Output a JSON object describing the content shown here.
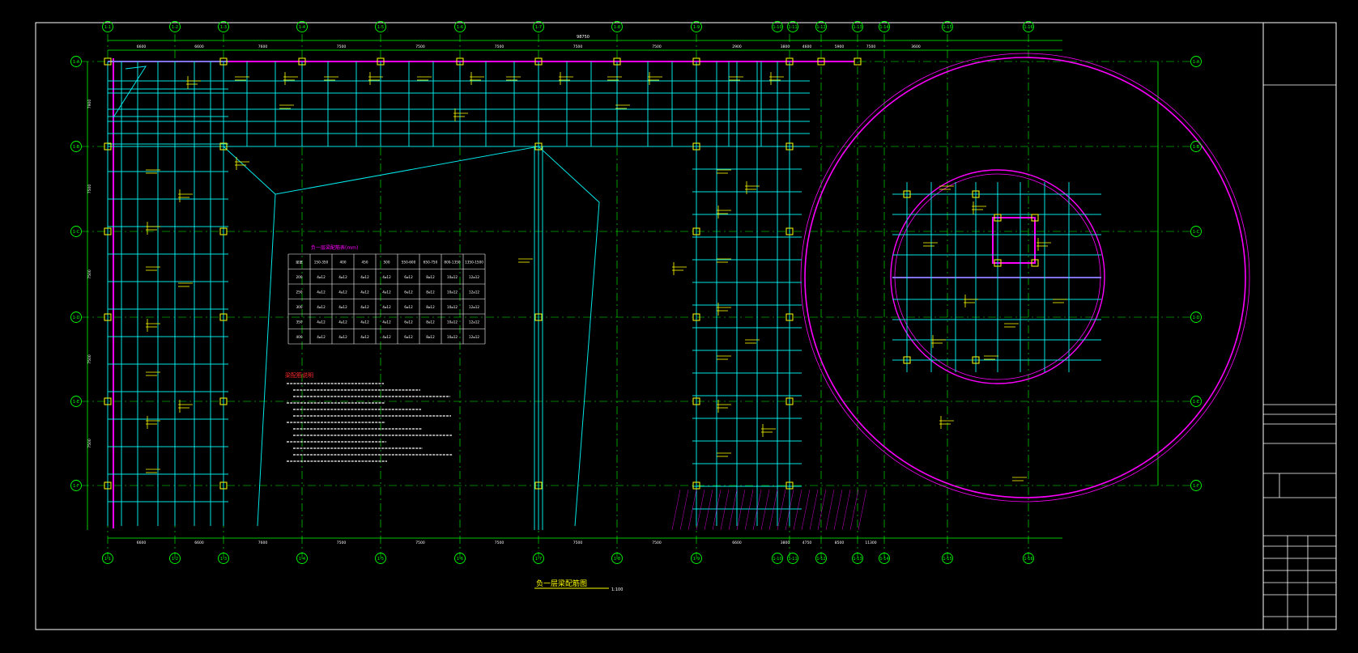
{
  "drawing": {
    "title": "负一层梁配筋图",
    "scale": "1:100",
    "notes_heading": "梁配筋说明",
    "table_title": "负一层梁配筋表(mm)",
    "table_headers": [
      "梁宽",
      "150-350",
      "400",
      "450",
      "500",
      "550-600",
      "650-750",
      "800-1350",
      "1350-1500"
    ],
    "table_rows": [
      [
        "200",
        "4⌀12",
        "4⌀12",
        "4⌀12",
        "4⌀12",
        "6⌀12",
        "8⌀12",
        "10⌀12",
        "12⌀12"
      ],
      [
        "250",
        "4⌀12",
        "4⌀12",
        "4⌀12",
        "4⌀12",
        "6⌀12",
        "8⌀12",
        "10⌀12",
        "12⌀12"
      ],
      [
        "300",
        "4⌀12",
        "4⌀12",
        "4⌀12",
        "4⌀12",
        "6⌀12",
        "8⌀12",
        "10⌀12",
        "12⌀12"
      ],
      [
        "350",
        "4⌀12",
        "4⌀12",
        "4⌀12",
        "4⌀12",
        "6⌀12",
        "8⌀12",
        "10⌀12",
        "12⌀12"
      ],
      [
        "400",
        "4⌀12",
        "4⌀12",
        "4⌀12",
        "4⌀12",
        "6⌀12",
        "8⌀12",
        "10⌀12",
        "12⌀12"
      ]
    ],
    "overall_dim": "98750",
    "axes_top": [
      "1-1",
      "1-2",
      "1-3",
      "1-4",
      "1-5",
      "1-6",
      "1-7",
      "1-8",
      "1-9",
      "1-10",
      "1-11",
      "1-12",
      "1-13",
      "1-14",
      "1-15",
      "1-16"
    ],
    "axes_left": [
      "1-A",
      "1-B",
      "1-C",
      "1-D",
      "1-E",
      "1-F"
    ],
    "dims_top": [
      "6600",
      "6600",
      "7600",
      "7500",
      "7500",
      "7500",
      "7500",
      "7500",
      "2900",
      "3800",
      "4600",
      "5900",
      "7500",
      "3600"
    ],
    "dims_bottom": [
      "6600",
      "6600",
      "7600",
      "7500",
      "7500",
      "7500",
      "7500",
      "7500",
      "6600",
      "3800",
      "4750",
      "8500",
      "11300"
    ],
    "dims_left": [
      "7900",
      "7500",
      "7500",
      "7500",
      "7500"
    ],
    "colors": {
      "background": "#000000",
      "frame": "#ffffff",
      "beam": "#00e5e5",
      "grid": "#00ff00",
      "wall": "#ff00ff",
      "label": "#ffff00",
      "note": "#ff2a2a",
      "text": "#ffffff",
      "column": "#ffff00"
    }
  }
}
